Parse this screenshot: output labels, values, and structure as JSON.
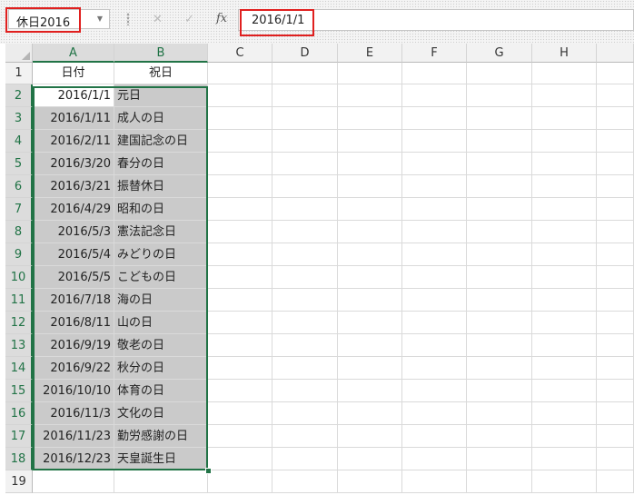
{
  "name_box": {
    "value": "休日2016",
    "dropdown_icon": "chevron-down-icon"
  },
  "formula_bar": {
    "cancel_icon": "✕",
    "enter_icon": "✓",
    "fx_label": "fx",
    "value": "2016/1/1"
  },
  "columns": [
    "A",
    "B",
    "C",
    "D",
    "E",
    "F",
    "G",
    "H"
  ],
  "rows": [
    "1",
    "2",
    "3",
    "4",
    "5",
    "6",
    "7",
    "8",
    "9",
    "10",
    "11",
    "12",
    "13",
    "14",
    "15",
    "16",
    "17",
    "18",
    "19"
  ],
  "header_row": {
    "a": "日付",
    "b": "祝日"
  },
  "holidays": [
    {
      "date": "2016/1/1",
      "name": "元日"
    },
    {
      "date": "2016/1/11",
      "name": "成人の日"
    },
    {
      "date": "2016/2/11",
      "name": "建国記念の日"
    },
    {
      "date": "2016/3/20",
      "name": "春分の日"
    },
    {
      "date": "2016/3/21",
      "name": "振替休日"
    },
    {
      "date": "2016/4/29",
      "name": "昭和の日"
    },
    {
      "date": "2016/5/3",
      "name": "憲法記念日"
    },
    {
      "date": "2016/5/4",
      "name": "みどりの日"
    },
    {
      "date": "2016/5/5",
      "name": "こどもの日"
    },
    {
      "date": "2016/7/18",
      "name": "海の日"
    },
    {
      "date": "2016/8/11",
      "name": "山の日"
    },
    {
      "date": "2016/9/19",
      "name": "敬老の日"
    },
    {
      "date": "2016/9/22",
      "name": "秋分の日"
    },
    {
      "date": "2016/10/10",
      "name": "体育の日"
    },
    {
      "date": "2016/11/3",
      "name": "文化の日"
    },
    {
      "date": "2016/11/23",
      "name": "勤労感謝の日"
    },
    {
      "date": "2016/12/23",
      "name": "天皇誕生日"
    }
  ],
  "colors": {
    "selection": "#217346",
    "highlight": "#e0201f"
  }
}
